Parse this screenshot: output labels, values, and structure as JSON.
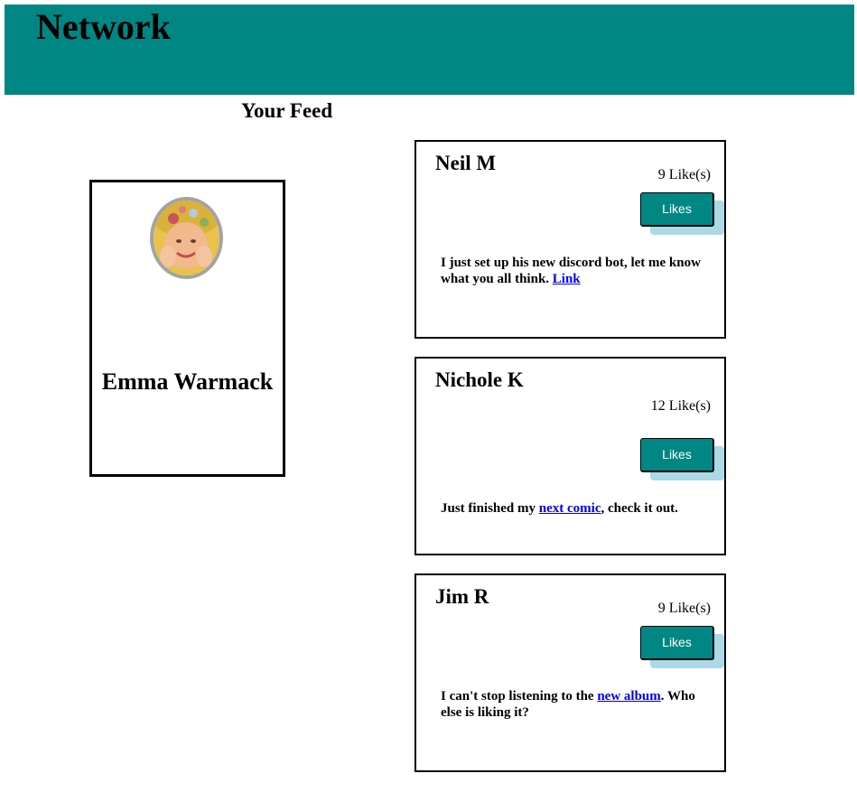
{
  "header": {
    "title": "Network",
    "background": "#008784"
  },
  "feed": {
    "heading": "Your Feed"
  },
  "profile": {
    "name": "Emma Warmack",
    "avatar_icon": "profile-photo"
  },
  "posts": [
    {
      "author": "Neil M",
      "likes": "9 Like(s)",
      "button_label": "Likes",
      "text_before": "I just set up his new discord bot, let me know what you all think. ",
      "link_text": "Link",
      "text_after": ""
    },
    {
      "author": "Nichole K",
      "likes": "12 Like(s)",
      "button_label": "Likes",
      "text_before": "Just finished my ",
      "link_text": "next comic",
      "text_after": ", check it out."
    },
    {
      "author": "Jim R",
      "likes": "9 Like(s)",
      "button_label": "Likes",
      "text_before": "I can't stop listening to the ",
      "link_text": "new album",
      "text_after": ". Who else is liking it?"
    }
  ],
  "colors": {
    "accent": "#008784",
    "button_shadow": "#add8e6",
    "link": "#0000ee"
  }
}
